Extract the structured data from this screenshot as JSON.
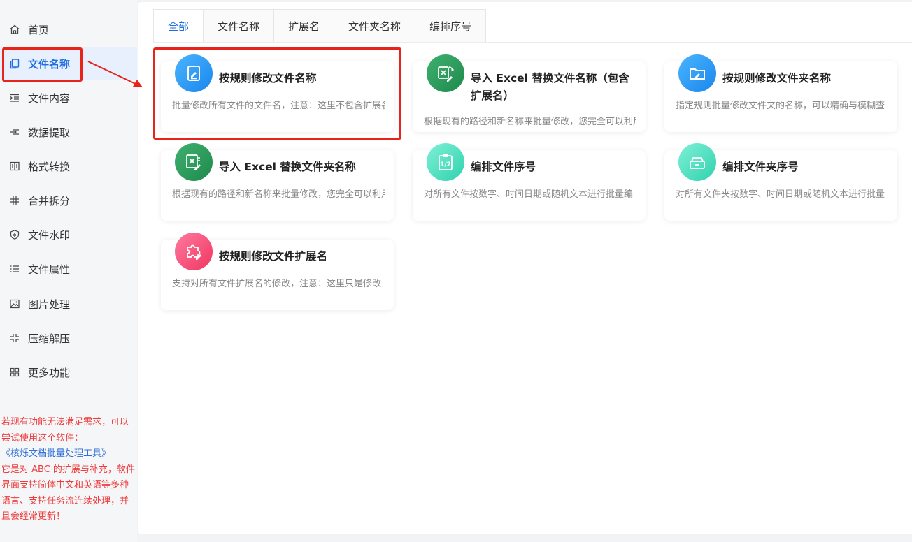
{
  "sidebar": {
    "items": [
      {
        "label": "首页",
        "icon": "home-icon"
      },
      {
        "label": "文件名称",
        "icon": "file-copy-icon"
      },
      {
        "label": "文件内容",
        "icon": "indent-icon"
      },
      {
        "label": "数据提取",
        "icon": "extract-icon"
      },
      {
        "label": "格式转换",
        "icon": "convert-icon"
      },
      {
        "label": "合并拆分",
        "icon": "hash-icon"
      },
      {
        "label": "文件水印",
        "icon": "shield-icon"
      },
      {
        "label": "文件属性",
        "icon": "list-icon"
      },
      {
        "label": "图片处理",
        "icon": "image-icon"
      },
      {
        "label": "压缩解压",
        "icon": "compress-icon"
      },
      {
        "label": "更多功能",
        "icon": "grid-icon"
      }
    ],
    "active_index": 1,
    "promo": {
      "line1": "若现有功能无法满足需求，可以尝试使用这个软件：",
      "link": "《核烁文档批量处理工具》",
      "line2": "它是对 ABC 的扩展与补充，软件界面支持简体中文和英语等多种语言、支持任务流连续处理，并且会经常更新！"
    }
  },
  "tabs": [
    "全部",
    "文件名称",
    "扩展名",
    "文件夹名称",
    "编排序号"
  ],
  "active_tab": 0,
  "cards": [
    {
      "title": "按规则修改文件名称",
      "desc": "批量修改所有文件的文件名，注意：这里不包含扩展名",
      "icon": "edit-file-icon"
    },
    {
      "title": "导入 Excel 替换文件名称（包含扩展名）",
      "desc": "根据现有的路径和新名称来批量修改，您完全可以利用",
      "icon": "excel-replace-icon"
    },
    {
      "title": "按规则修改文件夹名称",
      "desc": "指定规则批量修改文件夹的名称，可以精确与模糊查",
      "icon": "edit-folder-icon"
    },
    {
      "title": "导入 Excel 替换文件夹名称",
      "desc": "根据现有的路径和新名称来批量修改，您完全可以利用",
      "icon": "excel-edit-icon"
    },
    {
      "title": "编排文件序号",
      "desc": "对所有文件按数字、时间日期或随机文本进行批量编",
      "icon": "clipboard-number-icon"
    },
    {
      "title": "编排文件夹序号",
      "desc": "对所有文件夹按数字、时间日期或随机文本进行批量",
      "icon": "folder-number-icon"
    },
    {
      "title": "按规则修改文件扩展名",
      "desc": "支持对所有文件扩展名的修改，注意：这里只是修改",
      "icon": "puzzle-edit-icon"
    }
  ],
  "colors": {
    "accent": "#1f6fe0",
    "highlight": "#e8231a",
    "promo_text": "#ee3a3a",
    "icon_blue": "#1a8ff0",
    "icon_green": "#2b9a5a",
    "icon_teal": "#3fd6b8",
    "icon_pink": "#f0436e"
  }
}
